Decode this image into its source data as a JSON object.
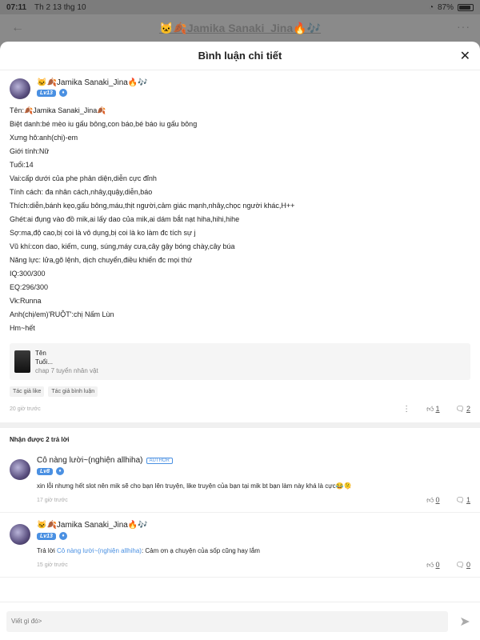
{
  "status_bar": {
    "time": "07:11",
    "date": "Th 2 13 thg 10",
    "battery": "87%",
    "battery_level": 0.87
  },
  "background_header": {
    "title": "🐱🍂Jamika Sanaki_Jina🔥🎶"
  },
  "sheet": {
    "title": "Bình luận chi tiết"
  },
  "main_comment": {
    "username": "🐱🍂Jamika Sanaki_Jina🔥🎶",
    "level": "Lv13",
    "lines": [
      "Tên:🍂Jamika Sanaki_Jina🍂",
      "Biệt danh:bé mèo iu gấu bông,con báo,bé báo iu gấu bông",
      "Xưng hô:anh(chị)-em",
      "Giới tính:Nữ",
      "Tuổi:14",
      "Vai:cấp dưới của phe phản diện,diễn cực đỉnh",
      "Tính cách: đa nhân cách,nhây,quậy,diễn,báo",
      "Thích:diễn,bánh kẹo,gấu bông,máu,thịt người,cảm giác mạnh,nhây,chọc người khác,H++",
      "Ghét:ai đụng vào đồ mik,ai lấy dao của mik,ai dám bắt nạt hiha,hihi,hihe",
      "Sợ:ma,độ cao,bị coi là vô dụng,bị coi là ko làm đc tích sự j",
      "Vũ khí:con dao, kiếm, cung, súng,máy cưa,cây gậy bóng chày,cây búa",
      "Năng lực: lửa,gõ lệnh, dịch chuyển,điều khiển đc mọi thứ",
      "IQ:300/300",
      "EQ:296/300",
      "Vk:Runna",
      "Anh(chị/em)'RUỘT':chị Nấm Lùn",
      "Hm~hết"
    ],
    "ref_card": {
      "line1": "Tên",
      "line2": "Tuổi...",
      "source": "chap 7 tuyển nhân vật"
    },
    "tags": [
      "Tác giả like",
      "Tác giả bình luận"
    ],
    "time": "20 giờ trước",
    "likes": "1",
    "comments": "2"
  },
  "replies": {
    "title": "Nhận được 2 trả lời",
    "items": [
      {
        "username": "Cô nàng lười~(nghiện allhiha)",
        "author_tag": "AUTHOR",
        "level": "Lv8",
        "prefix": "",
        "mention": "",
        "text": "xin lỗi nhưng hết slot nên mik sẽ cho bạn lên truyện, like truyện của bạn tại mik bt bạn làm này khá là cực😂🫠",
        "time": "17 giờ trước",
        "likes": "0",
        "comments": "1"
      },
      {
        "username": "🐱🍂Jamika Sanaki_Jina🔥🎶",
        "author_tag": "",
        "level": "Lv13",
        "prefix": "Trả lời ",
        "mention": "Cô nàng lười~(nghiện allhiha)",
        "text": ": Cảm ơn ạ chuyện của sốp cũng hay lắm",
        "time": "15 giờ trước",
        "likes": "0",
        "comments": "0"
      }
    ]
  },
  "composer": {
    "placeholder": "Viết gì đó>"
  }
}
